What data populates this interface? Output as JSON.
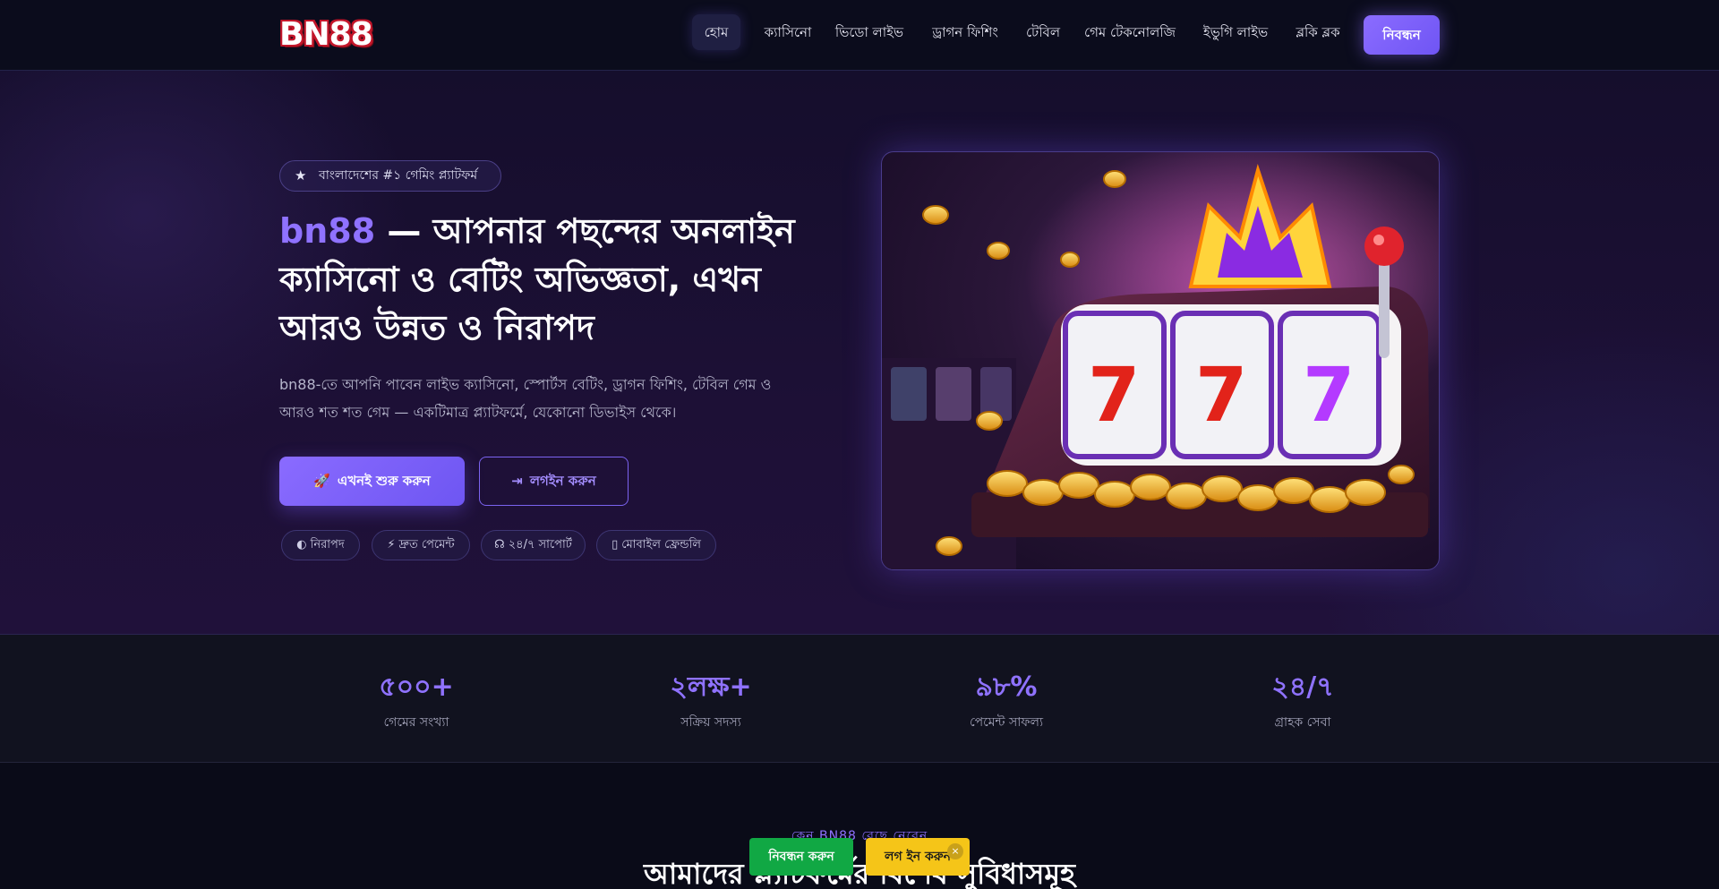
{
  "nav": {
    "logo": "BN88",
    "items": [
      {
        "label": "হোম",
        "active": true
      },
      {
        "label": "ক্যাসিনো"
      },
      {
        "label": "ভিডো লাইভ"
      },
      {
        "label": "ড্রাগন ফিশিং"
      },
      {
        "label": "টেবিল"
      },
      {
        "label": "গেম টেকনোলজি"
      },
      {
        "label": "ইভুগি লাইভ"
      },
      {
        "label": "ব্লকি ব্লক"
      }
    ],
    "register_label": "নিবন্ধন"
  },
  "hero": {
    "badge": "বাংলাদেশের #১ গেমিং প্ল্যাটফর্ম",
    "headline_brand": "bn88",
    "headline_rest": " — আপনার পছন্দের অনলাইন ক্যাসিনো ও বেটিং অভিজ্ঞতা, এখন আরও উন্নত ও নিরাপদ",
    "subtext": "bn88-তে আপনি পাবেন লাইভ ক্যাসিনো, স্পোর্টস বেটিং, ড্রাগন ফিশিং, টেবিল গেম ও আরও শত শত গেম — একটিমাত্র প্ল্যাটফর্মে, যেকোনো ডিভাইস থেকে।",
    "primary_button": "এখনই শুরু করুন",
    "secondary_button": "লগইন করুন",
    "chips": [
      "নিরাপদ",
      "দ্রুত পেমেন্ট",
      "২৪/৭ সাপোর্ট",
      "মোবাইল ফ্রেন্ডলি"
    ],
    "image_alt": "777"
  },
  "stats": [
    {
      "value": "৫০০+",
      "label": "গেমের সংখ্যা"
    },
    {
      "value": "২লক্ষ+",
      "label": "সক্রিয় সদস্য"
    },
    {
      "value": "৯৮%",
      "label": "পেমেন্ট সাফল্য"
    },
    {
      "value": "২৪/৭",
      "label": "গ্রাহক সেবা"
    }
  ],
  "features": {
    "tag": "কেন BN88 বেছে নেবেন",
    "title": "আমাদের প্ল্যাটফর্মের বিশেষ সুবিধাসমূহ"
  },
  "floating": {
    "register": "নিবন্ধন করুন",
    "login": "লগ ইন করুন",
    "close": "×"
  },
  "colors": {
    "accent": "#8f72ff",
    "register_green": "#11a844",
    "login_yellow": "#f5c518"
  }
}
